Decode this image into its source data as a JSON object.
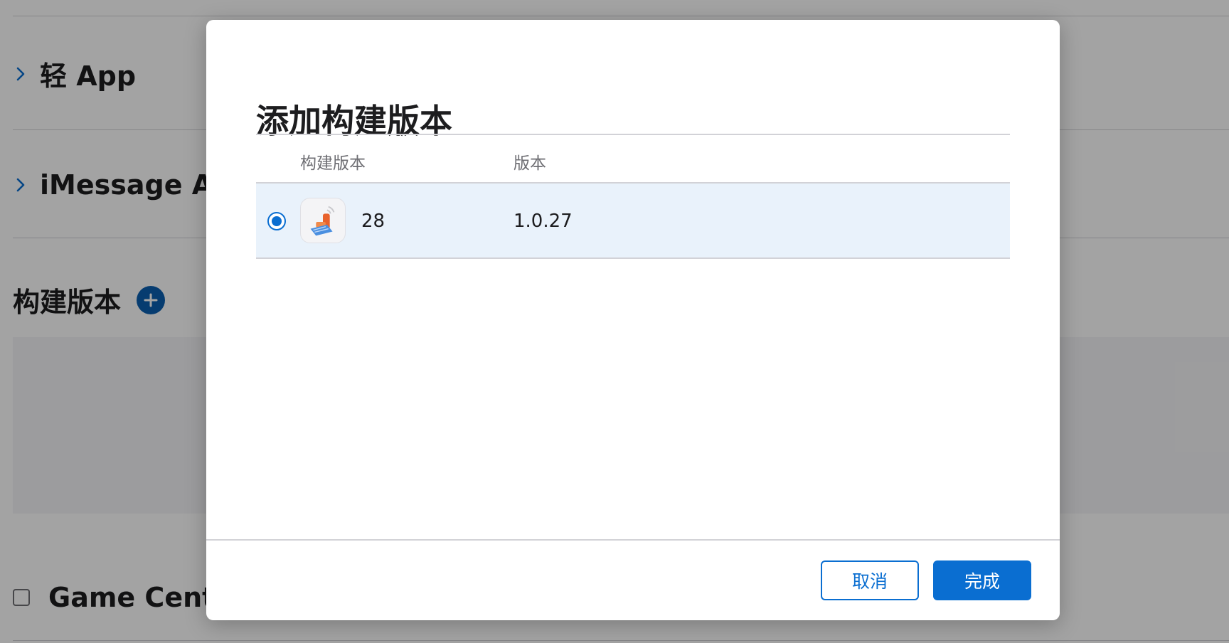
{
  "background": {
    "sections": [
      {
        "title": "轻 App"
      },
      {
        "title": "iMessage Ap"
      }
    ],
    "builds_heading": "构建版本",
    "game_center_label": "Game Cente"
  },
  "modal": {
    "title": "添加构建版本",
    "table": {
      "columns": [
        "构建版本",
        "版本"
      ],
      "rows": [
        {
          "build": "28",
          "version": "1.0.27",
          "selected": true
        }
      ]
    },
    "buttons": {
      "cancel": "取消",
      "done": "完成"
    }
  },
  "colors": {
    "accent": "#0a6ed1",
    "selected_row": "#e9f2fb"
  },
  "icons": [
    "chevron-right-icon",
    "plus-circle-icon",
    "app-icon"
  ]
}
